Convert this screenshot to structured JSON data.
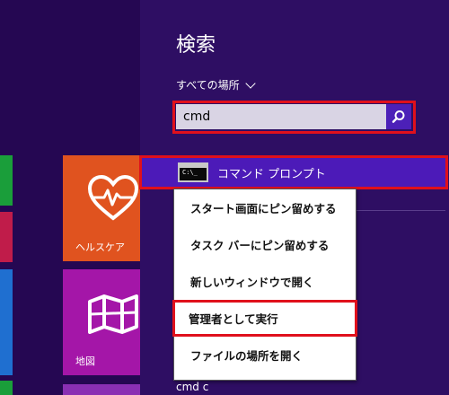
{
  "search": {
    "title": "検索",
    "scope_label": "すべての場所",
    "query": "cmd",
    "search_icon": "magnifier-icon"
  },
  "result": {
    "label": "コマンド プロンプト",
    "icon": "cmd-icon",
    "icon_text": "C:\\_"
  },
  "context_menu": {
    "items": [
      {
        "label": "スタート画面にピン留めする"
      },
      {
        "label": "タスク バーにピン留めする"
      },
      {
        "label": "新しいウィンドウで開く"
      },
      {
        "label": "管理者として実行",
        "highlighted": true
      },
      {
        "label": "ファイルの場所を開く"
      }
    ]
  },
  "tiles": {
    "health": {
      "label": "ヘルスケア",
      "color": "#e0531f",
      "icon": "heart-pulse-icon"
    },
    "maps": {
      "label": "地図",
      "color": "#a416a8",
      "icon": "map-icon"
    }
  },
  "bottom_hint": "cmd c",
  "colors": {
    "background": "#2b0a5e",
    "accent": "#4c1ab8",
    "highlight": "#e0101c",
    "search_button": "#4c20b8"
  }
}
